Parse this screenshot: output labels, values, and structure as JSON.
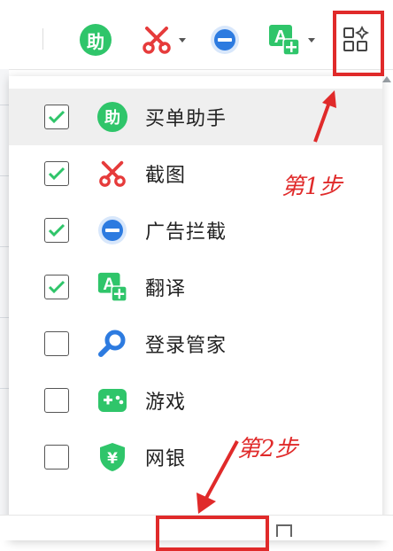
{
  "toolbar": {
    "buy_helper_glyph": "助",
    "translate_glyph": "A"
  },
  "menu": {
    "items": [
      {
        "label": "买单助手",
        "checked": true,
        "icon": "shopping-helper-icon"
      },
      {
        "label": "截图",
        "checked": true,
        "icon": "scissors-icon"
      },
      {
        "label": "广告拦截",
        "checked": true,
        "icon": "ad-block-icon"
      },
      {
        "label": "翻译",
        "checked": true,
        "icon": "translate-icon"
      },
      {
        "label": "登录管家",
        "checked": false,
        "icon": "magnifier-icon"
      },
      {
        "label": "游戏",
        "checked": false,
        "icon": "gamepad-icon"
      },
      {
        "label": "网银",
        "checked": false,
        "icon": "shield-yen-icon"
      }
    ]
  },
  "annotations": {
    "step1": "第1步",
    "step2": "第2步"
  },
  "colors": {
    "green": "#2fc56a",
    "red": "#e63b3b",
    "blue": "#2d7be0",
    "annotation_red": "#e02a2a"
  }
}
